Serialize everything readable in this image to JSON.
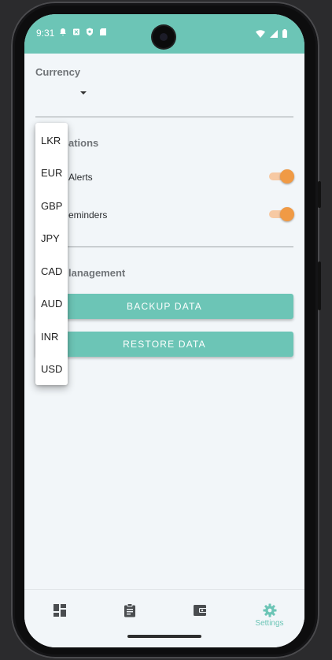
{
  "status_bar": {
    "time": "9:31"
  },
  "currency": {
    "label": "Currency"
  },
  "currency_dropdown": {
    "options": [
      "LKR",
      "EUR",
      "GBP",
      "JPY",
      "CAD",
      "AUD",
      "INR",
      "USD"
    ]
  },
  "notifications": {
    "label_partial": "ations",
    "items": [
      {
        "label_partial": "Alerts",
        "enabled": true
      },
      {
        "label_partial": "eminders",
        "enabled": true
      }
    ]
  },
  "data_management": {
    "label_partial": "lanagement",
    "backup_label": "BACKUP DATA",
    "restore_label": "RESTORE DATA"
  },
  "bottom_nav": {
    "items": [
      {
        "icon": "dashboard-icon",
        "label": ""
      },
      {
        "icon": "clipboard-icon",
        "label": ""
      },
      {
        "icon": "wallet-icon",
        "label": ""
      },
      {
        "icon": "gear-icon",
        "label": "Settings",
        "active": true
      }
    ]
  },
  "colors": {
    "accent": "#6cc5b6",
    "toggle_on": "#f09a45",
    "toggle_track": "#f7c9a3"
  }
}
